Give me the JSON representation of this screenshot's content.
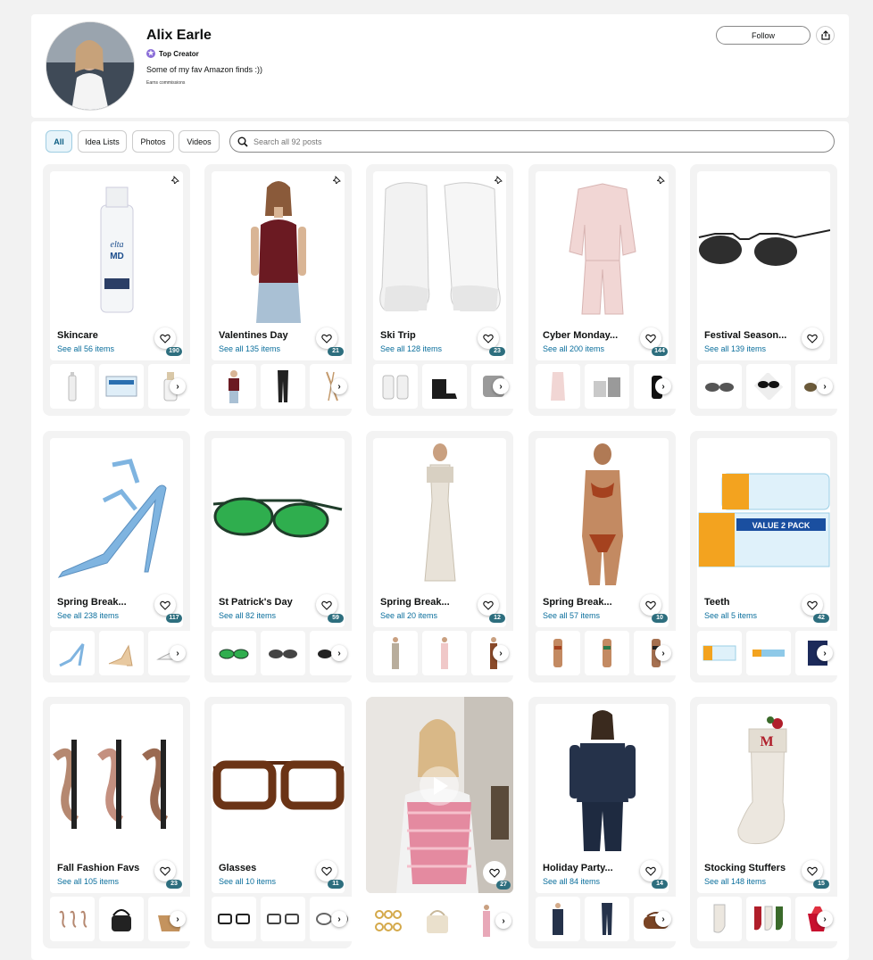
{
  "profile": {
    "name": "Alix Earle",
    "badge": "Top Creator",
    "bio": "Some of my fav Amazon finds :))",
    "earns": "Earns commissions",
    "follow_label": "Follow"
  },
  "filters": [
    {
      "label": "All",
      "active": true
    },
    {
      "label": "Idea Lists",
      "active": false
    },
    {
      "label": "Photos",
      "active": false
    },
    {
      "label": "Videos",
      "active": false
    }
  ],
  "search": {
    "placeholder": "Search all 92 posts"
  },
  "colors": {
    "accent": "#0a6e9c",
    "count_badge": "#2d6e7e",
    "active_tab": "#e8f4fa"
  },
  "cards": [
    {
      "title": "Skincare",
      "sub": "See all 56 items",
      "count": "190",
      "pinned": true,
      "image": "skincare-bottle"
    },
    {
      "title": "Valentines Day",
      "sub": "See all 135 items",
      "count": "21",
      "pinned": true,
      "image": "red-top-model"
    },
    {
      "title": "Ski Trip",
      "sub": "See all 128 items",
      "count": "23",
      "pinned": true,
      "image": "white-fur-boots"
    },
    {
      "title": "Cyber Monday...",
      "sub": "See all 200 items",
      "count": "144",
      "pinned": true,
      "image": "pink-pajamas"
    },
    {
      "title": "Festival Season...",
      "sub": "See all 139 items",
      "count": "",
      "pinned": false,
      "image": "black-sunglasses"
    },
    {
      "title": "Spring Break...",
      "sub": "See all 238 items",
      "count": "117",
      "pinned": false,
      "image": "blue-heels"
    },
    {
      "title": "St Patrick's Day",
      "sub": "See all 82 items",
      "count": "59",
      "pinned": false,
      "image": "green-sunglasses"
    },
    {
      "title": "Spring Break...",
      "sub": "See all 20 items",
      "count": "12",
      "pinned": false,
      "image": "white-dress-model"
    },
    {
      "title": "Spring Break...",
      "sub": "See all 57 items",
      "count": "10",
      "pinned": false,
      "image": "bikini-model"
    },
    {
      "title": "Teeth",
      "sub": "See all 5 items",
      "count": "42",
      "pinned": false,
      "image": "toothpaste"
    },
    {
      "title": "Fall Fashion Favs",
      "sub": "See all 105 items",
      "count": "23",
      "pinned": false,
      "image": "lip-liners"
    },
    {
      "title": "Glasses",
      "sub": "See all 10 items",
      "count": "11",
      "pinned": false,
      "image": "tortoise-glasses"
    },
    {
      "title": "",
      "sub": "",
      "count": "27",
      "pinned": false,
      "image": "video-post",
      "video": true
    },
    {
      "title": "Holiday Party...",
      "sub": "See all 84 items",
      "count": "14",
      "pinned": false,
      "image": "denim-model"
    },
    {
      "title": "Stocking Stuffers",
      "sub": "See all 148 items",
      "count": "15",
      "pinned": false,
      "image": "white-stocking"
    }
  ]
}
